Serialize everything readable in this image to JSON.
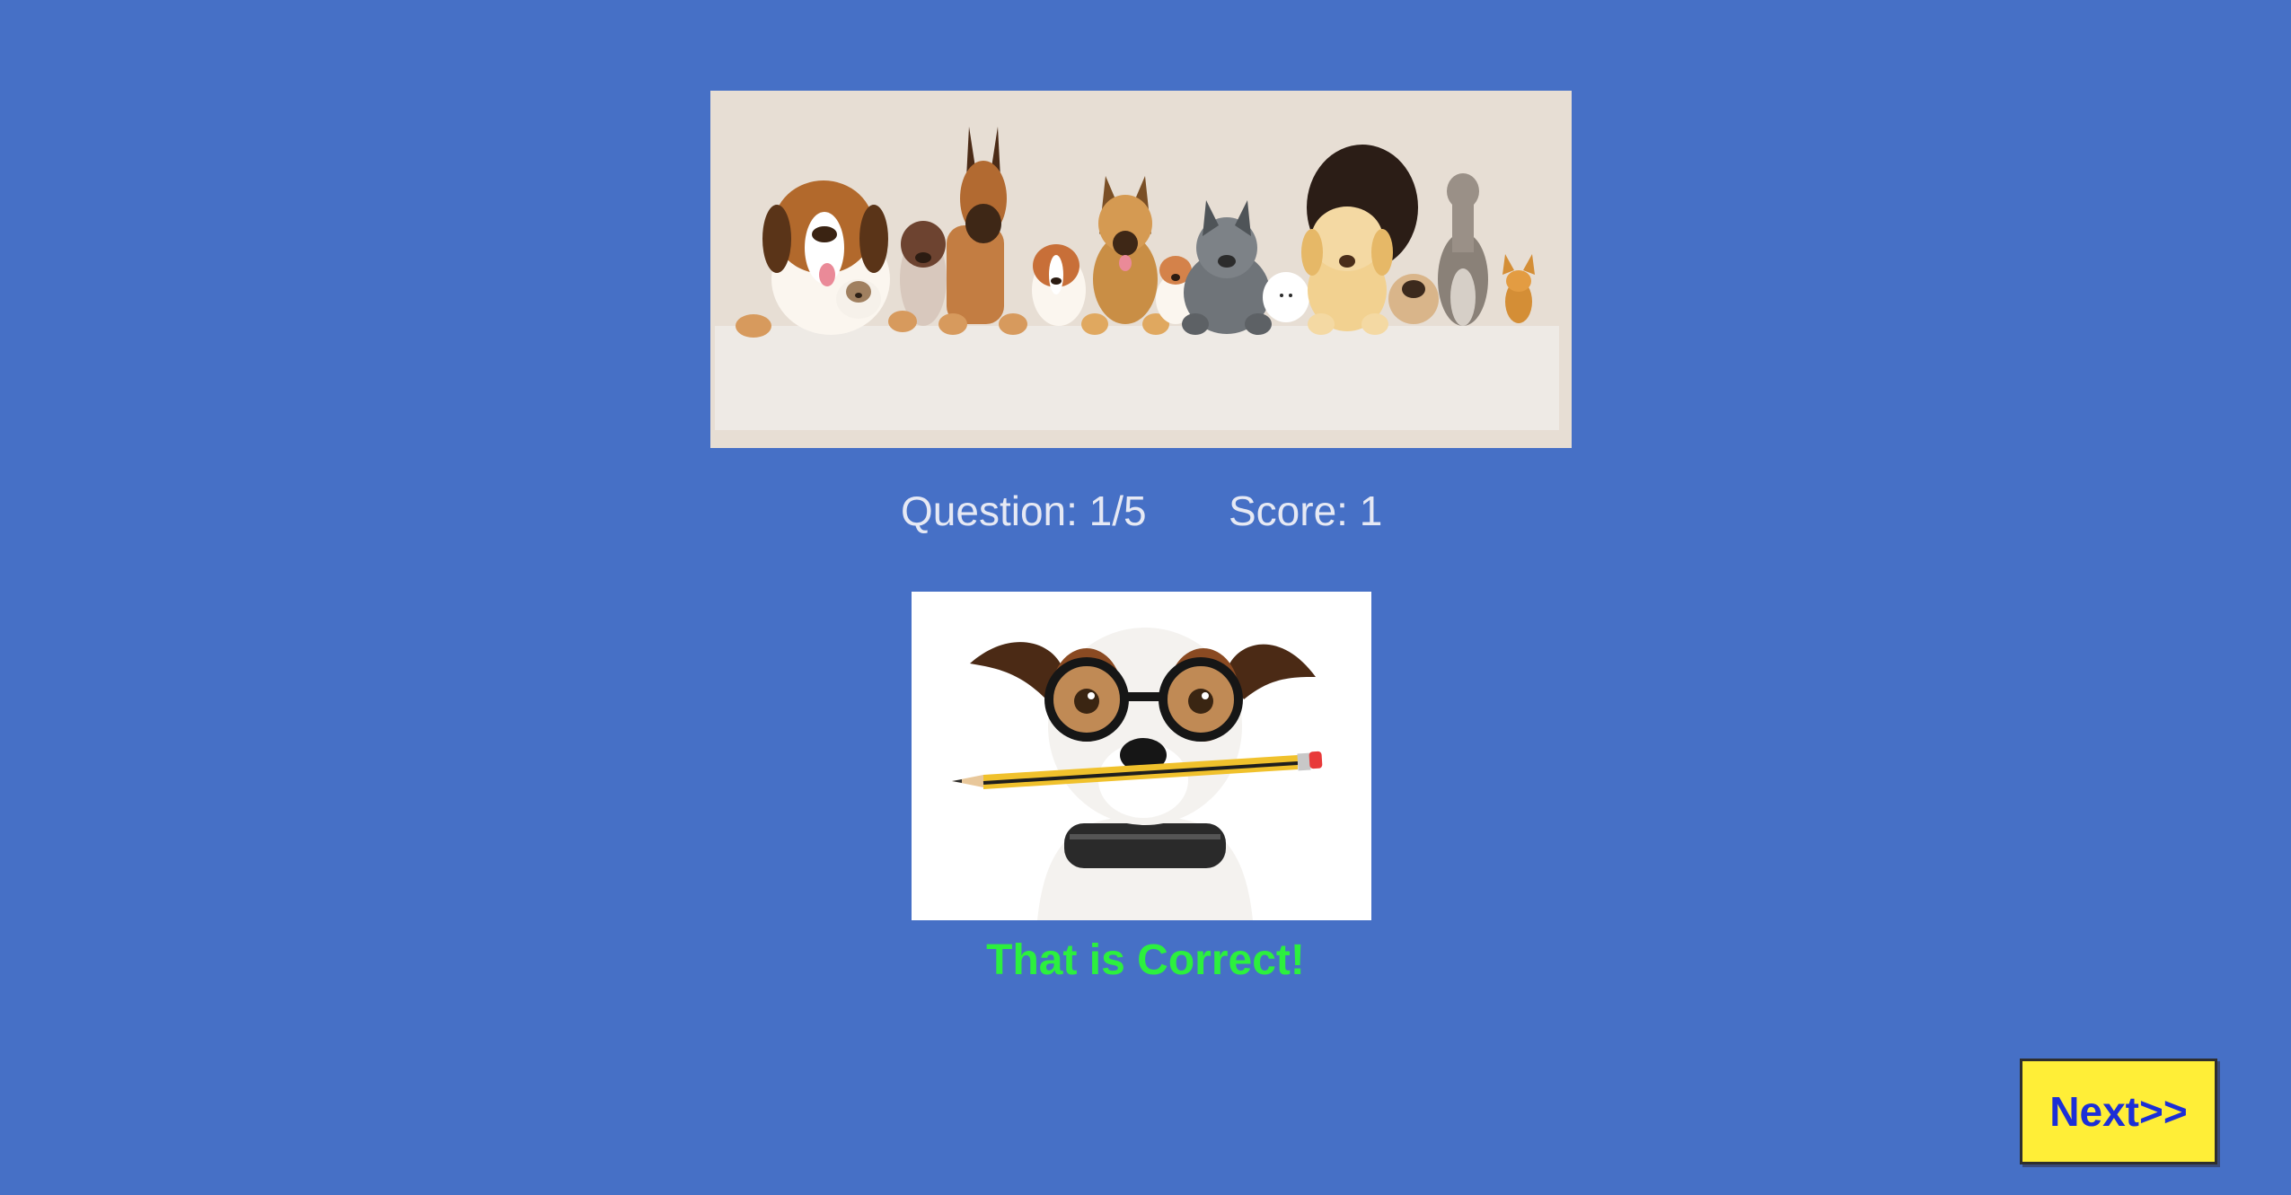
{
  "quiz": {
    "question_label": "Question: 1/5",
    "score_label": "Score: 1",
    "feedback": "That is Correct!",
    "next_label": "Next>>"
  },
  "images": {
    "banner": "dogs-lineup-illustration",
    "question_photo": "dog-with-glasses-and-pencil"
  },
  "colors": {
    "background": "#4670c6",
    "feedback": "#2cf03e",
    "next_button_bg": "#ffee37",
    "next_button_text": "#1c2fd6"
  }
}
